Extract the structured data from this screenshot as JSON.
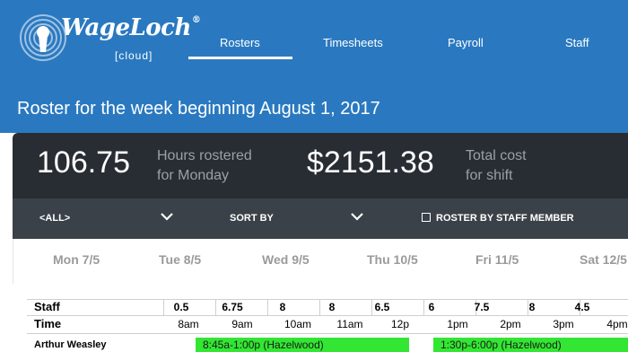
{
  "brand": {
    "name": "WageLoch",
    "registered": "®",
    "sub": "[cloud]"
  },
  "nav": {
    "items": [
      {
        "label": "Rosters",
        "active": true
      },
      {
        "label": "Timesheets",
        "active": false
      },
      {
        "label": "Payroll",
        "active": false
      },
      {
        "label": "Staff",
        "active": false
      }
    ]
  },
  "page": {
    "title": "Roster for the week beginning August 1, 2017"
  },
  "stats": {
    "hours_value": "106.75",
    "hours_label_line1": "Hours rostered",
    "hours_label_line2": "for Monday",
    "cost_value": "$2151.38",
    "cost_label_line1": "Total cost",
    "cost_label_line2": "for shift"
  },
  "filters": {
    "location": "<ALL>",
    "sort": "SORT BY",
    "roster_by_staff": "ROSTER BY STAFF MEMBER",
    "roster_by_staff_checked": false
  },
  "days": [
    "Mon 7/5",
    "Tue 8/5",
    "Wed 9/5",
    "Thu 10/5",
    "Fri 11/5",
    "Sat 12/5"
  ],
  "grid": {
    "staff_label": "Staff",
    "time_label": "Time",
    "hours": [
      "0.5",
      "6.75",
      "8",
      "8",
      "6.5",
      "6",
      "7.5",
      "8",
      "4.5"
    ],
    "times": [
      "8am",
      "9am",
      "10am",
      "11am",
      "12p",
      "1pm",
      "2pm",
      "3pm",
      "4pm"
    ],
    "rows": [
      {
        "name": "Arthur Weasley",
        "shifts": [
          {
            "label": "8:45a-1:00p (Hazelwood)"
          },
          {
            "label": "1:30p-6:00p (Hazelwood)"
          }
        ]
      }
    ]
  },
  "colors": {
    "header_bg": "#2a79c0",
    "stats_bg": "#282d33",
    "filter_bg": "#3b4148",
    "shift_green": "#33e633"
  }
}
